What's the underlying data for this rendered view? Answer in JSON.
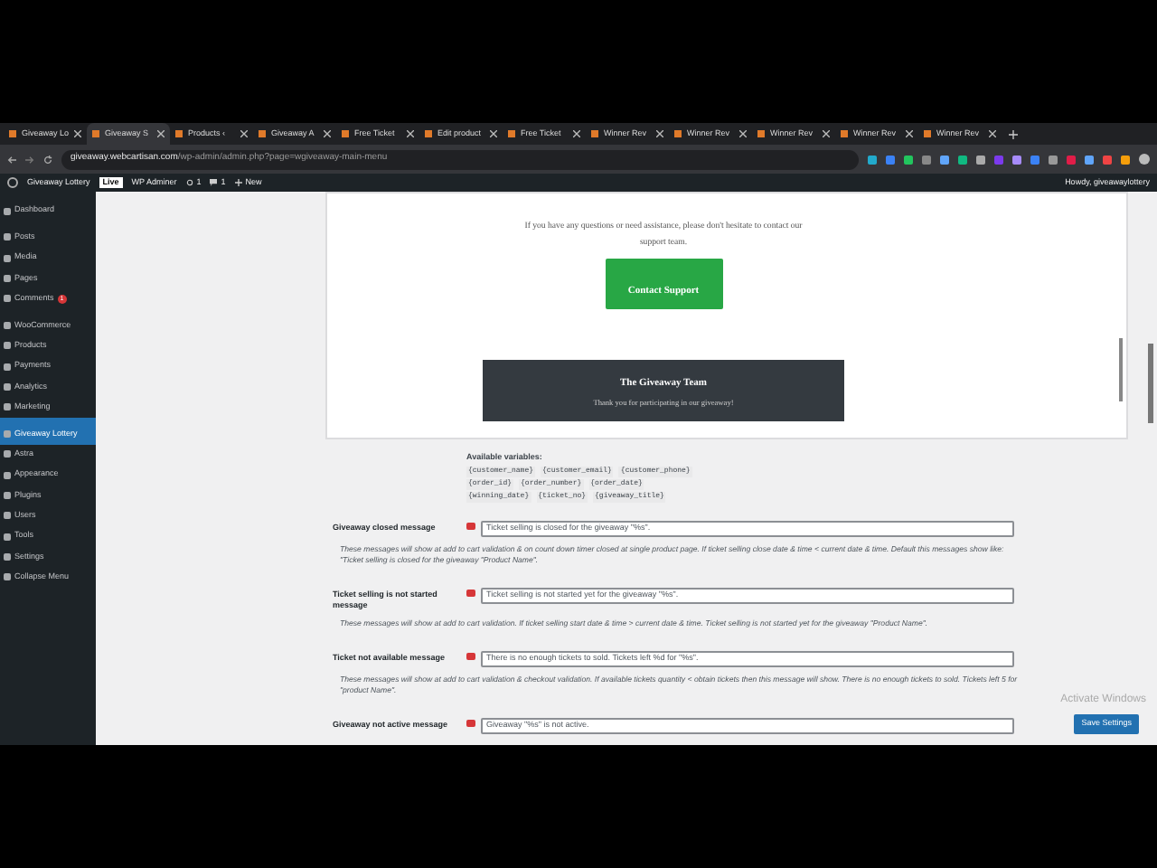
{
  "browser": {
    "tabs": [
      {
        "label": "Giveaway Lo",
        "selected": false
      },
      {
        "label": "Giveaway S",
        "selected": true
      },
      {
        "label": "Products ‹",
        "selected": false
      },
      {
        "label": "Giveaway A",
        "selected": false
      },
      {
        "label": "Free Ticket",
        "selected": false
      },
      {
        "label": "Edit product",
        "selected": false
      },
      {
        "label": "Free Ticket",
        "selected": false
      },
      {
        "label": "Winner Rev",
        "selected": false
      },
      {
        "label": "Winner Rev",
        "selected": false
      },
      {
        "label": "Winner Rev",
        "selected": false
      },
      {
        "label": "Winner Rev",
        "selected": false
      },
      {
        "label": "Winner Rev",
        "selected": false
      }
    ],
    "url_host": "giveaway.webcartisan.com",
    "url_path": "/wp-admin/admin.php?page=wgiveaway-main-menu"
  },
  "admin_bar": {
    "site": "Giveaway Lottery",
    "badge": "Live",
    "user": "WP Adminer",
    "updates": "1",
    "comments": "1",
    "new": "New",
    "howdy": "Howdy, giveawaylottery"
  },
  "sidebar": {
    "items": [
      {
        "label": "Dashboard",
        "selected": false,
        "gap": false
      },
      {
        "label": "Posts",
        "selected": false,
        "gap": true
      },
      {
        "label": "Media",
        "selected": false,
        "gap": false
      },
      {
        "label": "Pages",
        "selected": false,
        "gap": false
      },
      {
        "label": "Comments",
        "selected": false,
        "gap": false,
        "badge": "1"
      },
      {
        "label": "WooCommerce",
        "selected": false,
        "gap": true
      },
      {
        "label": "Products",
        "selected": false,
        "gap": false
      },
      {
        "label": "Payments",
        "selected": false,
        "gap": false
      },
      {
        "label": "Analytics",
        "selected": false,
        "gap": false
      },
      {
        "label": "Marketing",
        "selected": false,
        "gap": false
      },
      {
        "label": "Giveaway Lottery",
        "selected": true,
        "gap": true
      },
      {
        "label": "Astra",
        "selected": false,
        "gap": false
      },
      {
        "label": "Appearance",
        "selected": false,
        "gap": false
      },
      {
        "label": "Plugins",
        "selected": false,
        "gap": false
      },
      {
        "label": "Users",
        "selected": false,
        "gap": false
      },
      {
        "label": "Tools",
        "selected": false,
        "gap": false
      },
      {
        "label": "Settings",
        "selected": false,
        "gap": false
      },
      {
        "label": "Collapse Menu",
        "selected": false,
        "gap": false
      }
    ]
  },
  "email_preview": {
    "text": "If you have any questions or need assistance, please don't hesitate to contact our support team.",
    "button": "Contact Support",
    "footer_title": "The Giveaway Team",
    "footer_text": "Thank you for participating in our giveaway!"
  },
  "variables": {
    "label": "Available variables:",
    "tokens": [
      "{customer_name}",
      "{customer_email}",
      "{customer_phone}",
      "{order_id}",
      "{order_number}",
      "{order_date}",
      "{winning_date}",
      "{ticket_no}",
      "{giveaway_title}"
    ]
  },
  "fields": [
    {
      "label": "Giveaway closed message",
      "value": "Ticket selling is closed for the giveaway \"%s\".",
      "help": "These messages will show at add to cart validation & on count down timer closed at single product page. If ticket selling close date & time < current date & time. Default this messages show like: \"Ticket selling is closed for the giveaway \"Product Name\"."
    },
    {
      "label": "Ticket selling is not started message",
      "value": "Ticket selling is not started yet for the giveaway \"%s\".",
      "help": "These messages will show at add to cart validation. If ticket selling start date & time > current date & time. Ticket selling is not started yet for the giveaway \"Product Name\"."
    },
    {
      "label": "Ticket not available message",
      "value": "There is no enough tickets to sold. Tickets left %d for \"%s\".",
      "help": "These messages will show at add to cart validation & checkout validation. If available tickets quantity < obtain tickets then this message will show. There is no enough tickets to sold. Tickets left 5 for \"product Name\"."
    },
    {
      "label": "Giveaway not active message",
      "value": "Giveaway \"%s\" is not active."
    }
  ],
  "save_button": "Save Settings",
  "os_notice": "Activate Windows"
}
